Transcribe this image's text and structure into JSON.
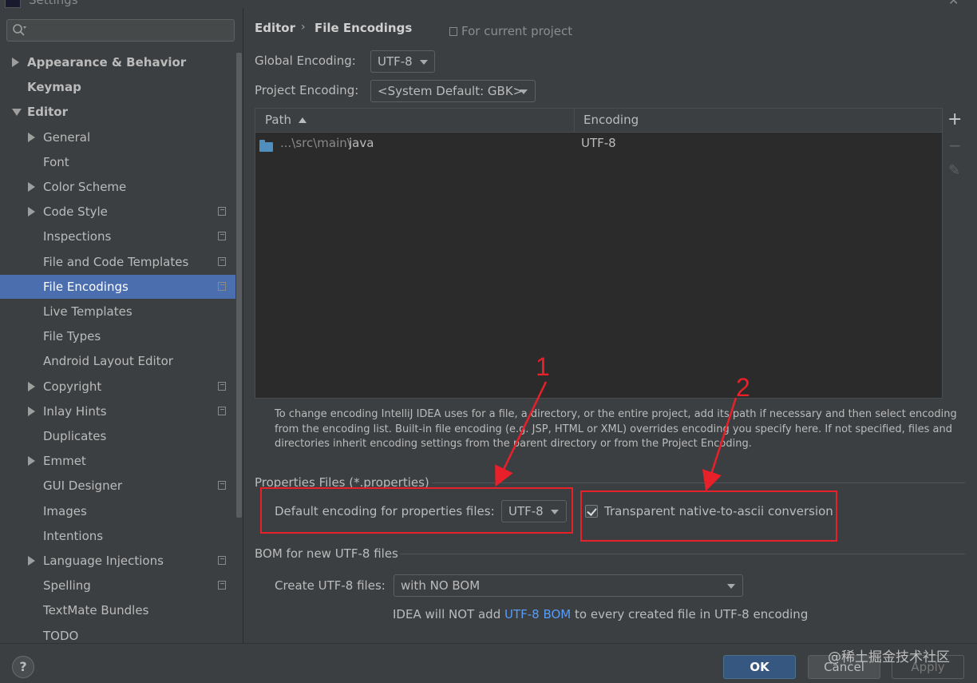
{
  "window": {
    "title": "Settings"
  },
  "search": {
    "placeholder": "",
    "icon": "search-icon"
  },
  "tree": [
    {
      "label": "Appearance & Behavior",
      "level": 0,
      "expander": "collapsed",
      "bold": true,
      "project_scope": false
    },
    {
      "label": "Keymap",
      "level": 0,
      "expander": "none",
      "bold": true,
      "project_scope": false
    },
    {
      "label": "Editor",
      "level": 0,
      "expander": "expanded",
      "bold": true,
      "project_scope": false
    },
    {
      "label": "General",
      "level": 1,
      "expander": "collapsed",
      "bold": false,
      "project_scope": false
    },
    {
      "label": "Font",
      "level": 1,
      "expander": "none",
      "bold": false,
      "project_scope": false
    },
    {
      "label": "Color Scheme",
      "level": 1,
      "expander": "collapsed",
      "bold": false,
      "project_scope": false
    },
    {
      "label": "Code Style",
      "level": 1,
      "expander": "collapsed",
      "bold": false,
      "project_scope": true
    },
    {
      "label": "Inspections",
      "level": 1,
      "expander": "none",
      "bold": false,
      "project_scope": true
    },
    {
      "label": "File and Code Templates",
      "level": 1,
      "expander": "none",
      "bold": false,
      "project_scope": true
    },
    {
      "label": "File Encodings",
      "level": 1,
      "expander": "none",
      "bold": false,
      "project_scope": true,
      "selected": true
    },
    {
      "label": "Live Templates",
      "level": 1,
      "expander": "none",
      "bold": false,
      "project_scope": false
    },
    {
      "label": "File Types",
      "level": 1,
      "expander": "none",
      "bold": false,
      "project_scope": false
    },
    {
      "label": "Android Layout Editor",
      "level": 1,
      "expander": "none",
      "bold": false,
      "project_scope": false
    },
    {
      "label": "Copyright",
      "level": 1,
      "expander": "collapsed",
      "bold": false,
      "project_scope": true
    },
    {
      "label": "Inlay Hints",
      "level": 1,
      "expander": "collapsed",
      "bold": false,
      "project_scope": true
    },
    {
      "label": "Duplicates",
      "level": 1,
      "expander": "none",
      "bold": false,
      "project_scope": false
    },
    {
      "label": "Emmet",
      "level": 1,
      "expander": "collapsed",
      "bold": false,
      "project_scope": false
    },
    {
      "label": "GUI Designer",
      "level": 1,
      "expander": "none",
      "bold": false,
      "project_scope": true
    },
    {
      "label": "Images",
      "level": 1,
      "expander": "none",
      "bold": false,
      "project_scope": false
    },
    {
      "label": "Intentions",
      "level": 1,
      "expander": "none",
      "bold": false,
      "project_scope": false
    },
    {
      "label": "Language Injections",
      "level": 1,
      "expander": "collapsed",
      "bold": false,
      "project_scope": true
    },
    {
      "label": "Spelling",
      "level": 1,
      "expander": "none",
      "bold": false,
      "project_scope": true
    },
    {
      "label": "TextMate Bundles",
      "level": 1,
      "expander": "none",
      "bold": false,
      "project_scope": false
    },
    {
      "label": "TODO",
      "level": 1,
      "expander": "none",
      "bold": false,
      "project_scope": false
    }
  ],
  "breadcrumb": {
    "parent": "Editor",
    "separator": "›",
    "current": "File Encodings"
  },
  "scope_note": {
    "icon": "project-scope-icon",
    "text": "For current project"
  },
  "global_encoding": {
    "label": "Global Encoding:",
    "value": "UTF-8"
  },
  "project_encoding": {
    "label": "Project Encoding:",
    "value": "<System Default: GBK>"
  },
  "table": {
    "columns": [
      "Path",
      "Encoding"
    ],
    "sorted_column": "Path",
    "sort_direction": "ascending",
    "rows": [
      {
        "path_prefix": "...\\src\\main\\",
        "path_name": "java",
        "encoding": "UTF-8"
      }
    ],
    "toolbar": [
      {
        "icon": "plus-icon",
        "symbol": "+"
      },
      {
        "icon": "minus-icon",
        "symbol": "−"
      },
      {
        "icon": "edit-icon",
        "symbol": "✎"
      }
    ]
  },
  "help_text": "To change encoding IntelliJ IDEA uses for a file, a directory, or the entire project, add its path if necessary and then select encoding from the encoding list. Built-in file encoding (e.g. JSP, HTML or XML) overrides encoding you specify here. If not specified, files and directories inherit encoding settings from the parent directory or from the Project Encoding.",
  "properties": {
    "section_title": "Properties Files (*.properties)",
    "default_label": "Default encoding for properties files:",
    "default_value": "UTF-8",
    "transparent_label": "Transparent native-to-ascii conversion",
    "transparent_checked": true
  },
  "bom": {
    "section_title": "BOM for new UTF-8 files",
    "create_label": "Create UTF-8 files:",
    "create_value": "with NO BOM",
    "note_before": "IDEA will NOT add ",
    "note_link": "UTF-8 BOM",
    "note_after": " to every created file in UTF-8 encoding"
  },
  "annotations": {
    "first": "1",
    "second": "2",
    "color": "#e8202a"
  },
  "buttons": {
    "help": "?",
    "ok": "OK",
    "cancel": "Cancel",
    "apply": "Apply"
  },
  "watermark": "@稀土掘金技术社区",
  "colors": {
    "selection": "#4b6eaf",
    "ok_button": "#365880",
    "link": "#589df6",
    "folder": "#4e8fbd"
  }
}
